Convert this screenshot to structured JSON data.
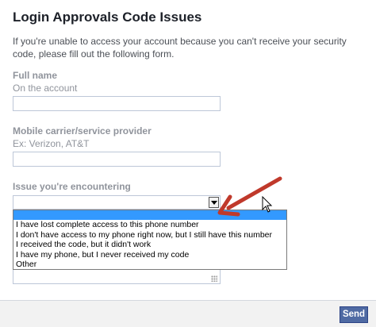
{
  "form": {
    "title": "Login Approvals Code Issues",
    "intro": "If you're unable to access your account because you can't receive your security code, please fill out the following form.",
    "full_name": {
      "label": "Full name",
      "hint": "On the account",
      "value": ""
    },
    "carrier": {
      "label": "Mobile carrier/service provider",
      "hint": "Ex: Verizon, AT&T",
      "value": ""
    },
    "issue": {
      "label": "Issue you're encountering",
      "selected": "",
      "options": [
        "I have lost complete access to this phone number",
        "I don't have access to my phone right now, but I still have this number",
        "I received the code, but it didn't work",
        "I have my phone, but I never received my code",
        "Other"
      ]
    },
    "send_label": "Send"
  },
  "colors": {
    "annotation_arrow": "#c0392b",
    "dropdown_highlight": "#3399ff",
    "send_button": "#4f6aa3"
  },
  "icons": {
    "dropdown": "chevron-down-icon",
    "cursor": "mouse-pointer-icon",
    "annotation": "annotation-arrow-icon",
    "resize": "resize-grip-icon"
  }
}
